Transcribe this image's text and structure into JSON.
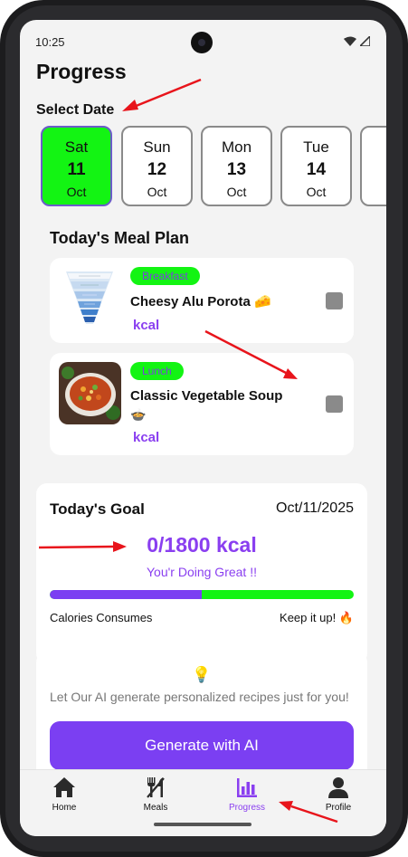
{
  "status_bar": {
    "time": "10:25"
  },
  "page": {
    "title": "Progress",
    "select_date_label": "Select Date"
  },
  "dates": [
    {
      "day": "Sat",
      "date": "11",
      "month": "Oct",
      "selected": true
    },
    {
      "day": "Sun",
      "date": "12",
      "month": "Oct",
      "selected": false
    },
    {
      "day": "Mon",
      "date": "13",
      "month": "Oct",
      "selected": false
    },
    {
      "day": "Tue",
      "date": "14",
      "month": "Oct",
      "selected": false
    }
  ],
  "meal_plan": {
    "title": "Today's Meal Plan",
    "meals": [
      {
        "type": "Breakfast",
        "name": "Cheesy Alu Porota 🧀",
        "kcal_label": "kcal",
        "checked": false
      },
      {
        "type": "Lunch",
        "name_line1": "Classic Vegetable Soup",
        "name_line2": "🍲",
        "kcal_label": "kcal",
        "checked": false
      }
    ]
  },
  "goal": {
    "title": "Today's Goal",
    "date": "Oct/11/2025",
    "value_text": "0/1800 kcal",
    "message": "You'r Doing Great !!",
    "progress_fraction": 0.5,
    "footer_left": "Calories Consumes",
    "footer_right": "Keep it up! 🔥"
  },
  "ai": {
    "bulb": "💡",
    "text": "Let Our AI generate personalized recipes just for you!",
    "button_label": "Generate with AI"
  },
  "nav": {
    "items": [
      {
        "label": "Home",
        "icon": "home-icon",
        "active": false
      },
      {
        "label": "Meals",
        "icon": "utensils-icon",
        "active": false
      },
      {
        "label": "Progress",
        "icon": "bar-chart-icon",
        "active": true
      },
      {
        "label": "Profile",
        "icon": "user-icon",
        "active": false
      }
    ]
  },
  "colors": {
    "accent_purple": "#7b3ff2",
    "accent_green": "#13f413",
    "annotation_arrow": "#e8141b"
  }
}
